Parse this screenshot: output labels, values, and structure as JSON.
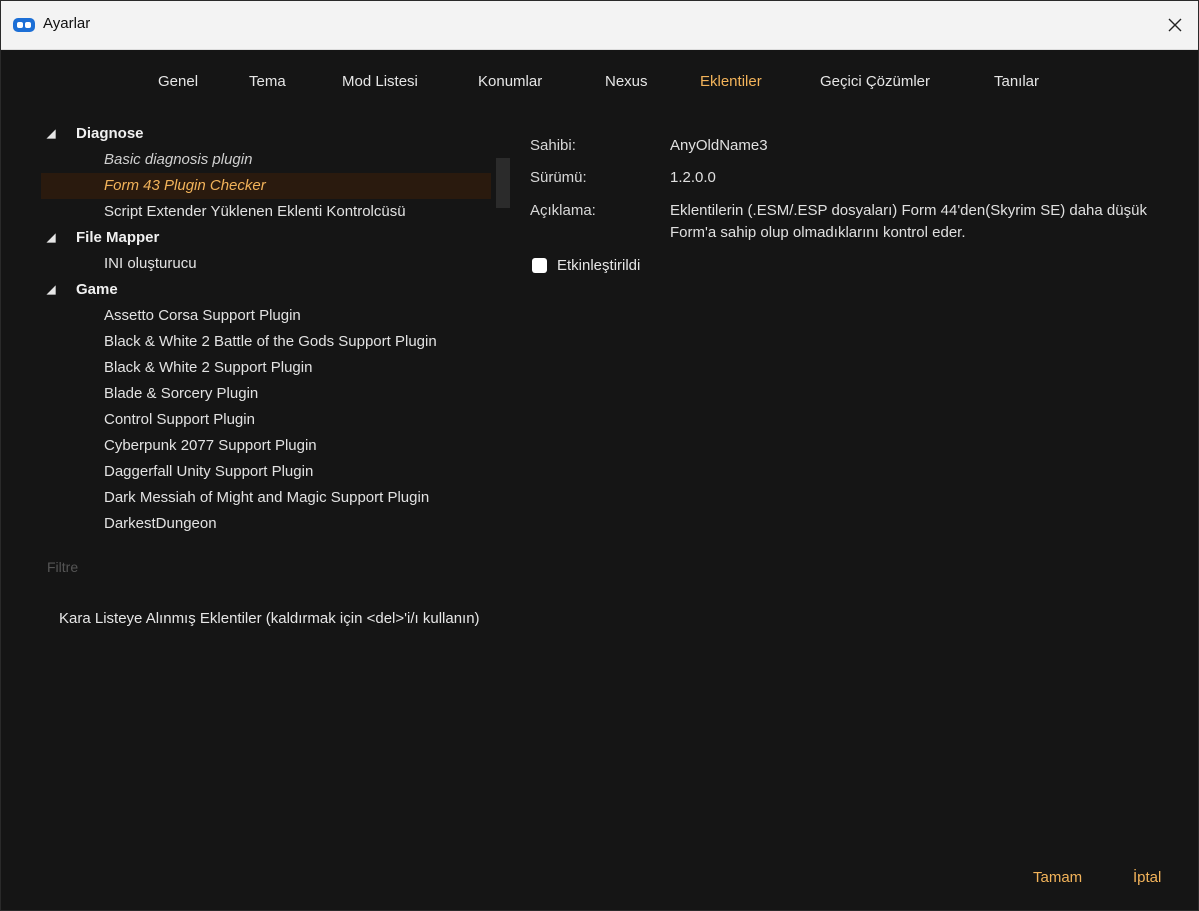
{
  "window": {
    "title": "Ayarlar"
  },
  "tabs": [
    {
      "label": "Genel"
    },
    {
      "label": "Tema"
    },
    {
      "label": "Mod Listesi"
    },
    {
      "label": "Konumlar"
    },
    {
      "label": "Nexus"
    },
    {
      "label": "Eklentiler",
      "active": true
    },
    {
      "label": "Geçici Çözümler"
    },
    {
      "label": "Tanılar"
    }
  ],
  "tree": {
    "groups": [
      {
        "label": "Diagnose",
        "items": [
          {
            "label": "Basic diagnosis plugin"
          },
          {
            "label": "Form 43 Plugin Checker"
          },
          {
            "label": "Script Extender Yüklenen Eklenti Kontrolcüsü"
          }
        ]
      },
      {
        "label": "File Mapper",
        "items": [
          {
            "label": "INI oluşturucu"
          }
        ]
      },
      {
        "label": "Game",
        "items": [
          {
            "label": "Assetto Corsa Support Plugin"
          },
          {
            "label": "Black & White 2 Battle of the Gods Support Plugin"
          },
          {
            "label": "Black & White 2 Support Plugin"
          },
          {
            "label": "Blade & Sorcery Plugin"
          },
          {
            "label": "Control Support Plugin"
          },
          {
            "label": "Cyberpunk 2077 Support Plugin"
          },
          {
            "label": "Daggerfall Unity Support Plugin"
          },
          {
            "label": "Dark Messiah of Might and Magic Support Plugin"
          },
          {
            "label": "DarkestDungeon"
          }
        ]
      }
    ]
  },
  "filter": {
    "placeholder": "Filtre"
  },
  "blacklist": {
    "label": "Kara Listeye Alınmış Eklentiler (kaldırmak için <del>'i/ı kullanın)"
  },
  "details": {
    "author_label": "Sahibi:",
    "author": "AnyOldName3",
    "version_label": "Sürümü:",
    "version": "1.2.0.0",
    "description_label": "Açıklama:",
    "description": "Eklentilerin (.ESM/.ESP dosyaları) Form 44'den(Skyrim SE) daha düşük Form'a sahip olup olmadıklarını kontrol eder.",
    "enabled_label": "Etkinleştirildi"
  },
  "footer": {
    "ok": "Tamam",
    "cancel": "İptal"
  },
  "colors": {
    "accent": "#f2b35a",
    "background": "#151515",
    "selected_row": "#2a1a0e"
  },
  "icons": {
    "app": "mo2-logo-icon",
    "close": "close-icon",
    "expand": "triangle-down-icon"
  }
}
